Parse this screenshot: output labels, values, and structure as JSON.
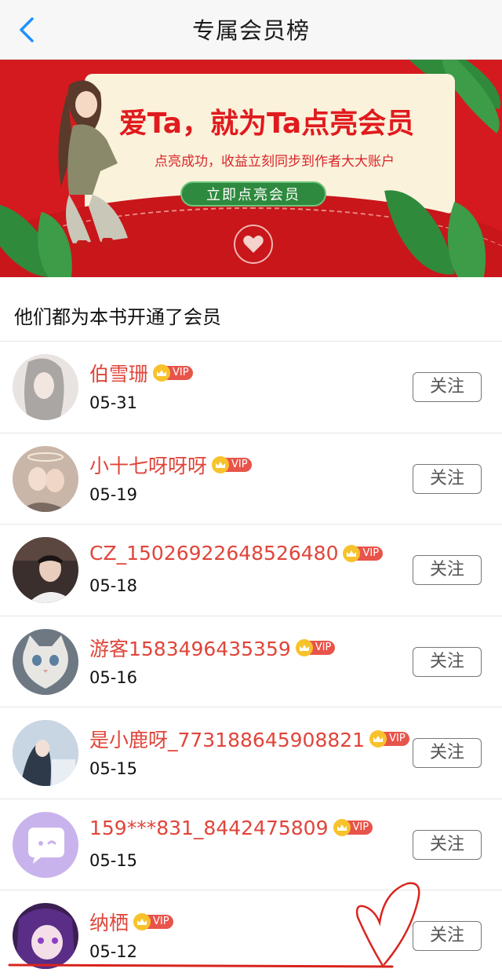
{
  "nav": {
    "title": "专属会员榜"
  },
  "banner": {
    "headline": "爱Ta，就为Ta点亮会员",
    "subtitle": "点亮成功，收益立刻同步到作者大大账户",
    "cta_label": "立即点亮会员"
  },
  "section": {
    "title": "他们都为本书开通了会员"
  },
  "vip_label": "VIP",
  "follow_label": "关注",
  "members": [
    {
      "name": "伯雪珊",
      "date": "05-31",
      "avatar_bg": "#e9e4e2"
    },
    {
      "name": "小十七呀呀呀",
      "date": "05-19",
      "avatar_bg": "#c9b6a8"
    },
    {
      "name": "CZ_15026922648526480",
      "date": "05-18",
      "avatar_bg": "#3a2f2c"
    },
    {
      "name": "游客1583496435359",
      "date": "05-16",
      "avatar_bg": "#6d7883"
    },
    {
      "name": "是小鹿呀_773188645908821",
      "date": "05-15",
      "avatar_bg": "#9fb4c8"
    },
    {
      "name": "159***831_8442475809",
      "date": "05-15",
      "avatar_bg": "#c9b3ec"
    },
    {
      "name": "纳栖",
      "date": "05-12",
      "avatar_bg": "#3b1f52"
    }
  ],
  "colors": {
    "accent_red": "#e0453a",
    "banner_red": "#d41a1f",
    "vip_gold": "#f7c22c",
    "nav_blue": "#1e90ff"
  }
}
